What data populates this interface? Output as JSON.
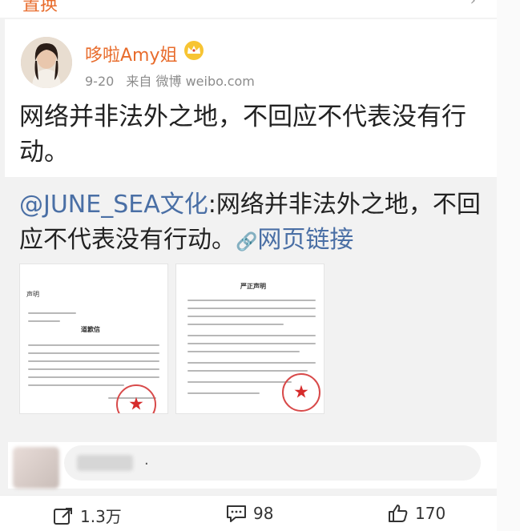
{
  "topbar": {
    "text": "置换",
    "icon": "chevron-icon"
  },
  "post": {
    "username": "哆啦Amy姐",
    "badge": "crown-icon",
    "date": "9-20",
    "source": "来自 微博 weibo.com",
    "text": "网络并非法外之地，不回应不代表没有行动。"
  },
  "repost": {
    "mention": "@JUNE_SEA文化",
    "text": ":网络并非法外之地，不回应不代表没有行动。",
    "link_icon": "link-icon",
    "link_label": "网页链接",
    "images": [
      {
        "title_left": "声明",
        "title_center": "道歉信"
      },
      {
        "title_center": "严正声明"
      }
    ]
  },
  "comment": {
    "placeholder": "."
  },
  "actions": {
    "repost_count": "1.3万",
    "comment_count": "98",
    "like_count": "170"
  },
  "colors": {
    "username": "#e86c2c",
    "link": "#4a6fa5",
    "stamp": "#d84a4a"
  }
}
